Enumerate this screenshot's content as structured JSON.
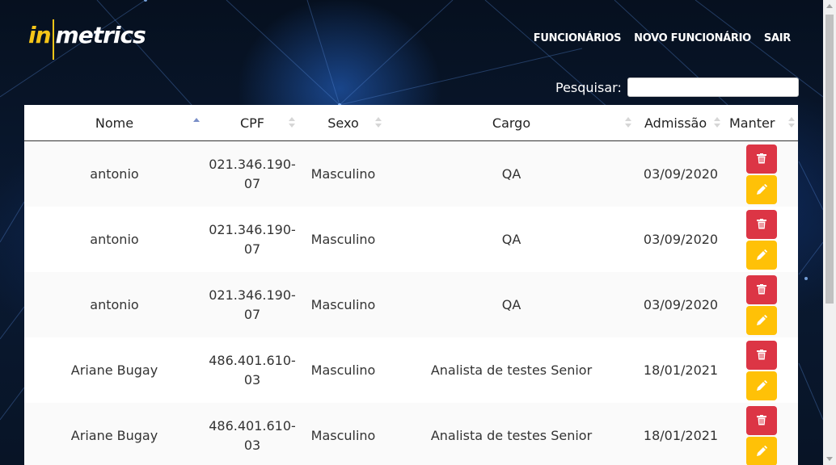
{
  "brand": {
    "in": "in",
    "metrics": "metrics"
  },
  "nav": {
    "items": [
      "FUNCIONÁRIOS",
      "NOVO FUNCIONÁRIO",
      "SAIR"
    ]
  },
  "search": {
    "label": "Pesquisar:",
    "value": ""
  },
  "table": {
    "headers": [
      "Nome",
      "CPF",
      "Sexo",
      "Cargo",
      "Admissão",
      "Manter"
    ],
    "sorted_column": "Nome",
    "sort_direction": "ascending",
    "rows": [
      {
        "nome": "antonio",
        "cpf_a": "021.346.190-",
        "cpf_b": "07",
        "sexo": "Masculino",
        "cargo": "QA",
        "admissao": "03/09/2020"
      },
      {
        "nome": "antonio",
        "cpf_a": "021.346.190-",
        "cpf_b": "07",
        "sexo": "Masculino",
        "cargo": "QA",
        "admissao": "03/09/2020"
      },
      {
        "nome": "antonio",
        "cpf_a": "021.346.190-",
        "cpf_b": "07",
        "sexo": "Masculino",
        "cargo": "QA",
        "admissao": "03/09/2020"
      },
      {
        "nome": "Ariane Bugay",
        "cpf_a": "486.401.610-",
        "cpf_b": "03",
        "sexo": "Masculino",
        "cargo": "Analista de testes Senior",
        "admissao": "18/01/2021"
      },
      {
        "nome": "Ariane Bugay",
        "cpf_a": "486.401.610-",
        "cpf_b": "03",
        "sexo": "Masculino",
        "cargo": "Analista de testes Senior",
        "admissao": "18/01/2021"
      }
    ]
  },
  "icons": {
    "delete": "trash-icon",
    "edit": "pencil-icon"
  },
  "colors": {
    "brand_yellow": "#f5c518",
    "delete": "#dc3545",
    "edit": "#ffc107",
    "sort_active": "#7a8fc8"
  }
}
